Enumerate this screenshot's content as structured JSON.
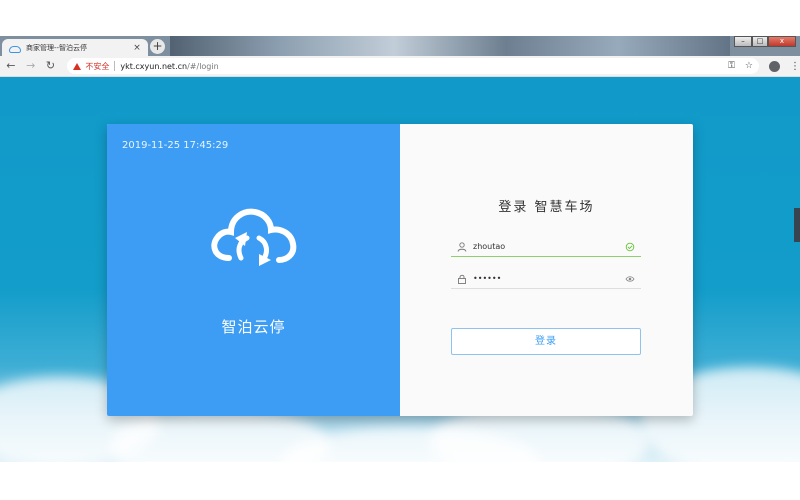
{
  "browser": {
    "tab_title": "商家管理--智泊云停",
    "tab_close": "×",
    "new_tab": "+",
    "insecure_label": "不安全",
    "url_host": "ykt.cxyun.net.cn",
    "url_path": "/#/login"
  },
  "login_card": {
    "datetime": "2019-11-25 17:45:29",
    "brand_name": "智泊云停",
    "title": "登录 智慧车场",
    "username_value": "zhoutao",
    "password_value": "••••••",
    "submit_label": "登录"
  },
  "colors": {
    "accent": "#3d9df4",
    "background": "#119ac9",
    "valid": "#8fcf6e",
    "warning": "#d93025"
  },
  "icons": [
    "cloud-refresh-icon",
    "user-icon",
    "lock-icon",
    "check-circle-icon",
    "eye-icon",
    "key-icon",
    "star-icon",
    "account-icon",
    "menu-icon",
    "back-icon",
    "forward-icon",
    "reload-icon"
  ]
}
